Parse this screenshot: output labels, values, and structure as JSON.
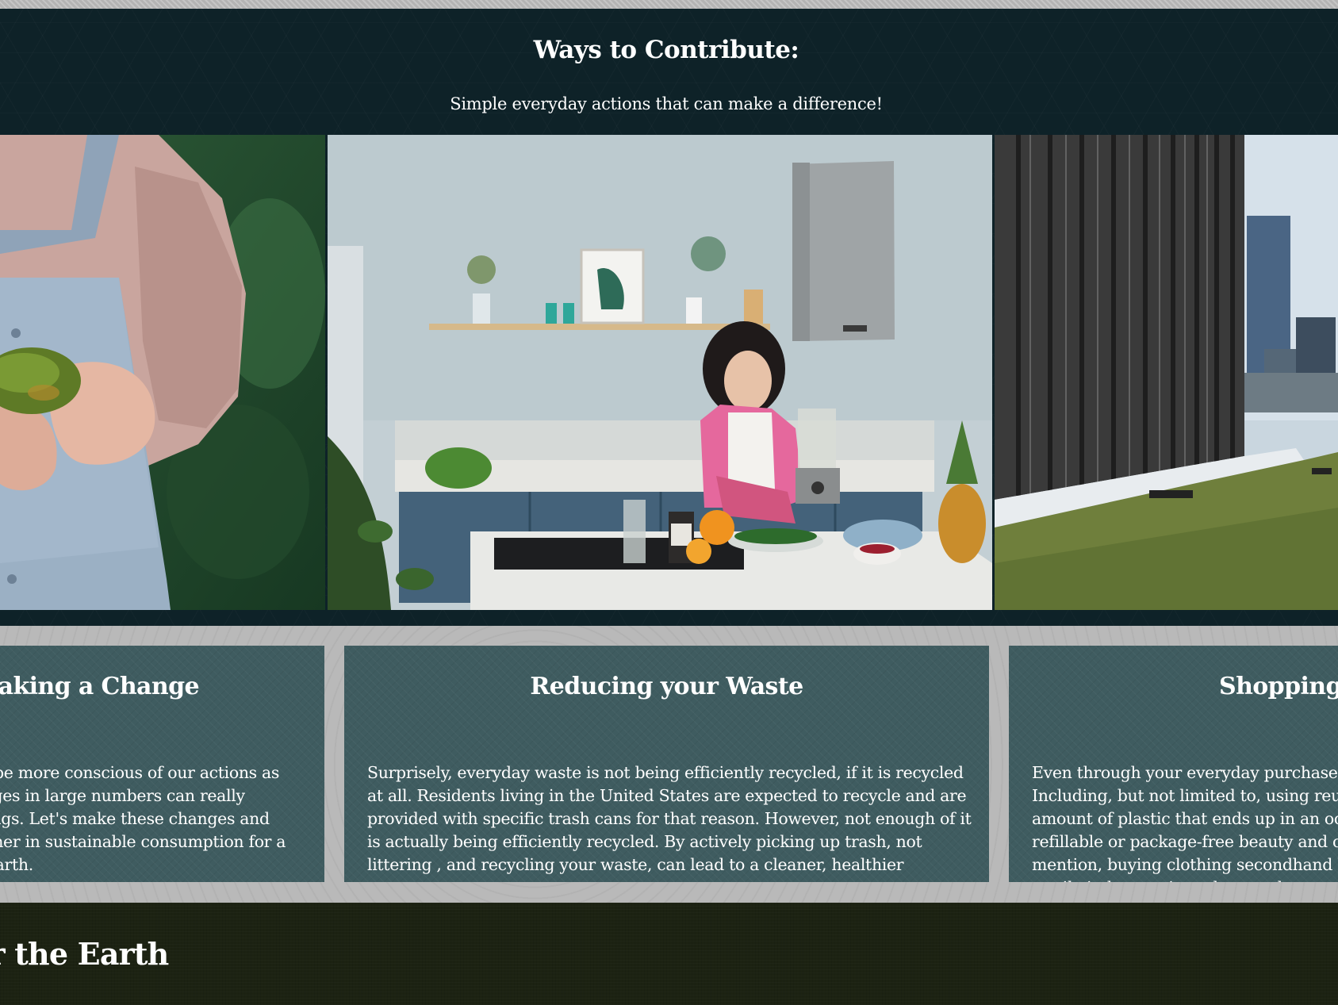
{
  "contribute": {
    "title": "Ways to Contribute:",
    "subtitle": "Simple everyday actions that can make a difference!"
  },
  "photos": {
    "left_icon": "person-holding-fruit-photo",
    "middle_icon": "kitchen-cooking-photo",
    "right_icon": "green-roof-building-photo"
  },
  "cards": [
    {
      "title": "Making a Change",
      "text": "We should be more conscious of our actions as small changes in large numbers can really change things. Let's make these changes and work together in sustainable consumption for a healthier Earth."
    },
    {
      "title": "Reducing your Waste",
      "text": "Surprisely, everyday waste is not being efficiently recycled, if it is recycled at all. Residents living in the United States are expected to recycle and are provided with specific trash cans for that reason. However, not enough of it is actually being efficiently recycled. By actively picking up trash, not littering , and recycling your waste, can lead to a cleaner, healthier ecosystem."
    },
    {
      "title": "Shopping Sustainably",
      "text": "Even through your everyday purchases can make a difference. Including, but not limited to, using reusable shopping bags, the amount of plastic that ends up in an ocean are reduced. Buying refillable or package-free beauty and cleaning products. Not to mention, buying clothing secondhand helps to reduce the huge textile industry, since they are known to pollute."
    }
  ],
  "footer": {
    "title": "For the Earth"
  },
  "colors": {
    "header_bg": "#0e2228",
    "card_bg": "#3f5c60",
    "band_bg": "#b9b9b9",
    "footer_bg": "#1c2212"
  }
}
